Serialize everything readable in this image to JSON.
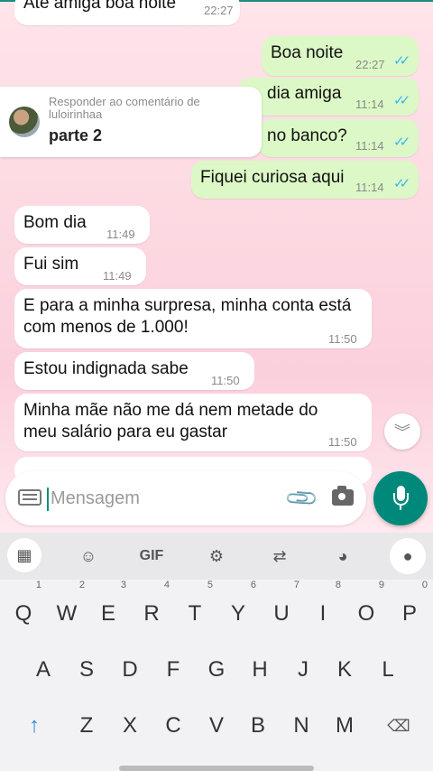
{
  "chat": {
    "messages": [
      {
        "dir": "in",
        "text": "Ate amiga boa noite",
        "time": "22:27"
      },
      {
        "dir": "out",
        "text": "Boa noite",
        "time": "22:27"
      },
      {
        "dir": "out",
        "text": "dia amiga",
        "time": "11:14"
      },
      {
        "dir": "out",
        "text": "no banco?",
        "time": "11:14"
      },
      {
        "dir": "out",
        "text": "Fiquei curiosa aqui",
        "time": "11:14"
      },
      {
        "dir": "in",
        "text": "Bom dia",
        "time": "11:49"
      },
      {
        "dir": "in",
        "text": "Fui sim",
        "time": "11:49"
      },
      {
        "dir": "in",
        "text": "E para a minha surpresa, minha conta está com menos de 1.000!",
        "time": "11:50"
      },
      {
        "dir": "in",
        "text": "Estou indignada sabe",
        "time": "11:50"
      },
      {
        "dir": "in",
        "text": "Minha mãe não me dá nem metade do meu salário para eu gastar",
        "time": "11:50"
      }
    ],
    "reply_overlay": {
      "label": "Responder ao comentário de luloirinhaa",
      "title": "parte 2"
    },
    "scroll_down_icon": "chevrons-down-icon"
  },
  "composer": {
    "placeholder": "Mensagem",
    "value": ""
  },
  "keyboard_toolbar": {
    "gif_label": "GIF"
  },
  "keyboard": {
    "row1": [
      {
        "key": "Q",
        "num": "1"
      },
      {
        "key": "W",
        "num": "2"
      },
      {
        "key": "E",
        "num": "3"
      },
      {
        "key": "R",
        "num": "4"
      },
      {
        "key": "T",
        "num": "5"
      },
      {
        "key": "Y",
        "num": "6"
      },
      {
        "key": "U",
        "num": "7"
      },
      {
        "key": "I",
        "num": "8"
      },
      {
        "key": "O",
        "num": "9"
      },
      {
        "key": "P",
        "num": "0"
      }
    ],
    "row2": [
      "A",
      "S",
      "D",
      "F",
      "G",
      "H",
      "J",
      "K",
      "L"
    ],
    "row3": [
      "Z",
      "X",
      "C",
      "V",
      "B",
      "N",
      "M"
    ],
    "shift_symbol": "↑",
    "backspace_symbol": "⌫"
  },
  "colors": {
    "outgoing_bubble": "#dcf8c6",
    "incoming_bubble": "#ffffff",
    "accent": "#00897b",
    "read_ticks": "#34b7f1"
  }
}
